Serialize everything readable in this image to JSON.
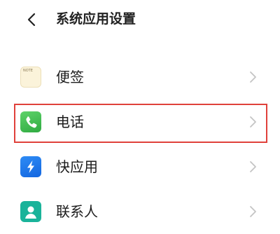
{
  "header": {
    "back_icon": "chevron-left-icon",
    "title": "系统应用设置"
  },
  "apps": [
    {
      "label": "便签",
      "icon": "notes-icon",
      "icon_text": "NOTE"
    },
    {
      "label": "电话",
      "icon": "phone-icon"
    },
    {
      "label": "快应用",
      "icon": "quick-app-icon"
    },
    {
      "label": "联系人",
      "icon": "contacts-icon"
    }
  ],
  "colors": {
    "highlight": "#e0413b",
    "chevron": "#c4c4c4",
    "phone_green": "#3dbd4e",
    "quick_blue": "#1f78ea",
    "contacts_teal": "#1ab39a"
  }
}
